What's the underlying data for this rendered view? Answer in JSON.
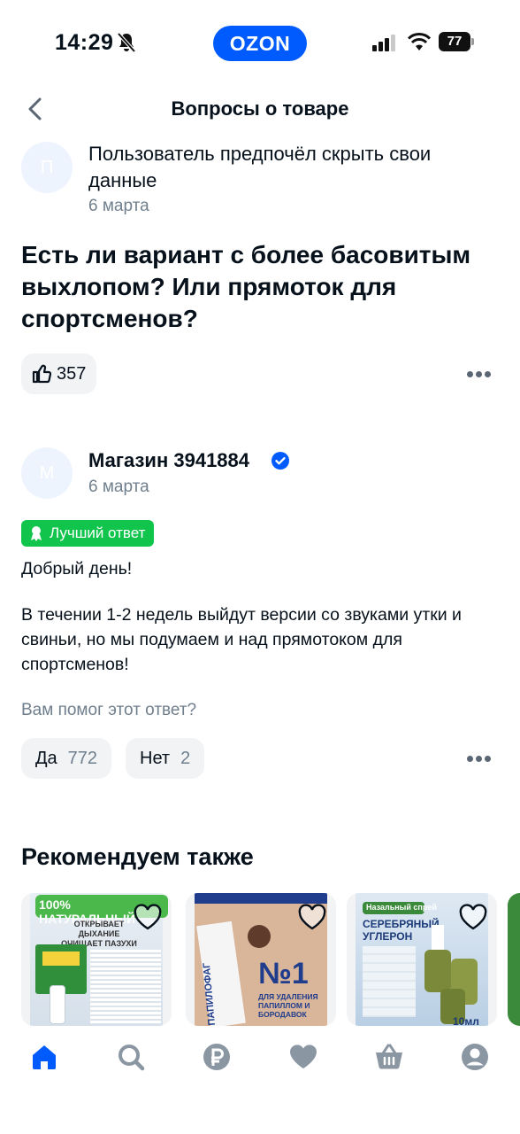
{
  "status_bar": {
    "time": "14:29",
    "brand": "OZON",
    "battery": "77"
  },
  "header": {
    "title": "Вопросы о товаре"
  },
  "question": {
    "avatar_letter": "П",
    "author": "Пользователь предпочёл скрыть свои данные",
    "date": "6 марта",
    "text": "Есть ли вариант с более басовитым выхлопом? Или прямоток для спортсменов?",
    "likes": "357"
  },
  "answer": {
    "avatar_letter": "М",
    "author": "Магазин 3941884",
    "date": "6 марта",
    "badge": "Лучший ответ",
    "greeting": "Добрый день!",
    "body": "В течении 1-2 недель выйдут версии со звуками утки и свиньи, но мы подумаем и над прямотоком для спортсменов!",
    "helpful_question": "Вам помог этот ответ?",
    "yes_label": "Да",
    "yes_count": "772",
    "no_label": "Нет",
    "no_count": "2"
  },
  "recommended": {
    "title": "Рекомендуем также",
    "cards": [
      {
        "banner": "100% НАТУРАЛЬНЫЙ",
        "subtitle": "ОТКРЫВАЕТ ДЫХАНИЕ ОЧИЩАЕТ ПАЗУХИ"
      },
      {
        "brand": "ПАПИЛОФАГ",
        "headline": "№1",
        "subtitle": "ДЛЯ УДАЛЕНИЯ ПАПИЛЛОМ И БОРОДАВОК"
      },
      {
        "tag": "Назальный спрей",
        "headline": "СЕРЕБРЯНЫЙ УГЛЕРОН",
        "volume": "10мл"
      }
    ]
  },
  "colors": {
    "brand": "#005bff",
    "best": "#10c44c",
    "muted": "#707f8d"
  },
  "tabs": [
    "home-icon",
    "search-icon",
    "ruble-icon",
    "heart-icon",
    "cart-icon",
    "profile-icon"
  ]
}
